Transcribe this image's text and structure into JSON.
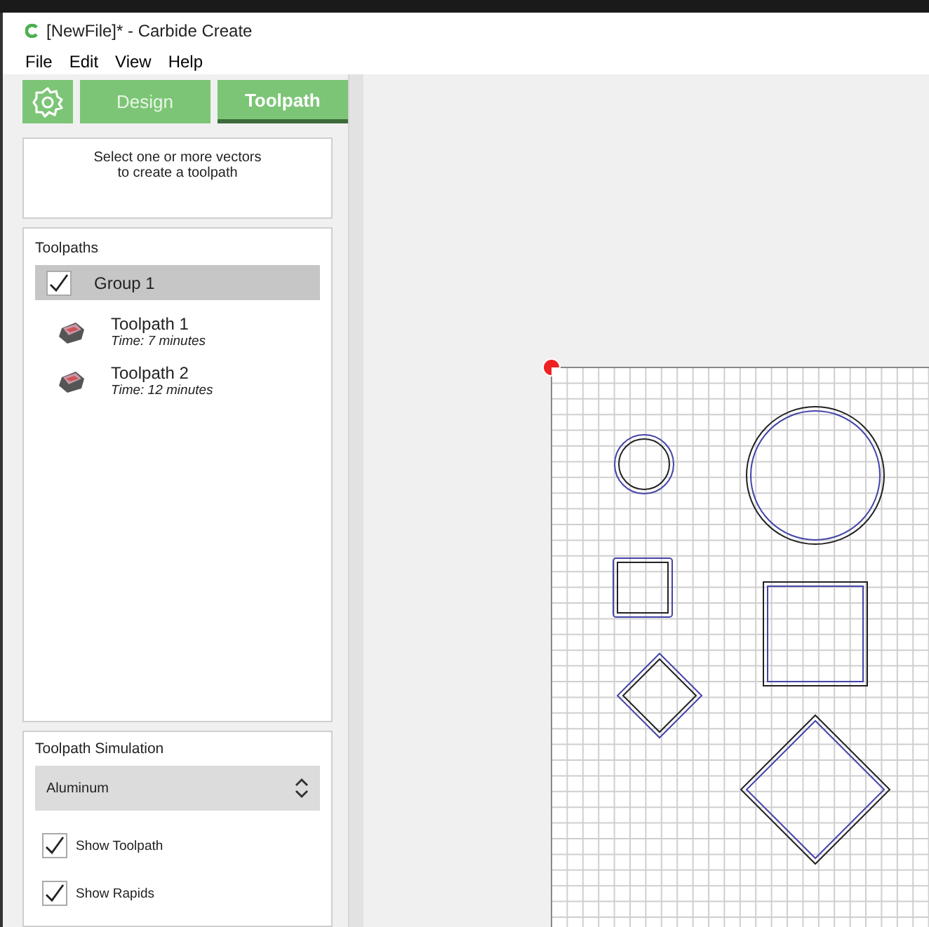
{
  "window": {
    "title": "[NewFile]* - Carbide Create"
  },
  "menu": [
    "File",
    "Edit",
    "View",
    "Help"
  ],
  "tabs": [
    {
      "kind": "settings",
      "selected": false
    },
    {
      "kind": "text",
      "label": "Design",
      "selected": false
    },
    {
      "kind": "text",
      "label": "Toolpath",
      "selected": true
    }
  ],
  "hint": "Select one or more vectors\nto create a toolpath",
  "toolpaths": {
    "title": "Toolpaths",
    "group": {
      "label": "Group 1",
      "checked": true,
      "selected": true
    },
    "items": [
      {
        "name": "Toolpath 1",
        "time": "Time: 7 minutes"
      },
      {
        "name": "Toolpath 2",
        "time": "Time: 12 minutes"
      }
    ]
  },
  "simulation": {
    "title": "Toolpath Simulation",
    "material": "Aluminum",
    "options": [
      {
        "label": "Show Toolpath",
        "checked": true
      },
      {
        "label": "Show Rapids",
        "checked": true
      }
    ]
  }
}
